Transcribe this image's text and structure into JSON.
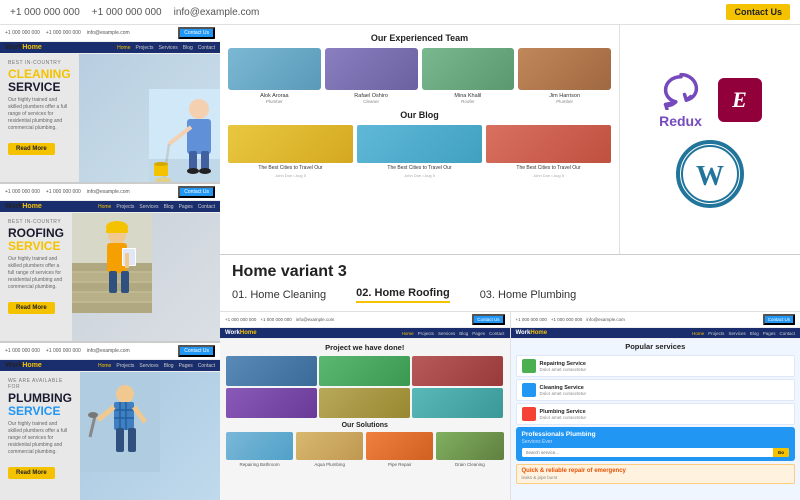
{
  "topbar": {
    "phone1": "+1 000 000 000",
    "phone2": "+1 000 000 000",
    "email": "info@example.com",
    "contact_btn": "Contact Us"
  },
  "previews": [
    {
      "id": "cleaning",
      "logo": "Work",
      "logo_accent": "Home",
      "tag": "BEST IN-COUNTRY",
      "headline_line1": "CLEANING",
      "headline_line2": "SERVICE",
      "desc": "Our highly trained and skilled plumbers offer a full range of services for residential plumbing and commercial plumbing.",
      "btn": "Read More",
      "nav": [
        "Home",
        "Projects",
        "Services",
        "Blog",
        "Contact"
      ],
      "type": "cleaning"
    },
    {
      "id": "roofing",
      "logo": "Work",
      "logo_accent": "Home",
      "tag": "BEST IN-COUNTRY",
      "headline_line1": "ROOFING",
      "headline_line2": "SERVICE",
      "desc": "Our highly trained and skilled plumbers offer a full range of services for residential plumbing and commercial plumbing.",
      "btn": "Read More",
      "nav": [
        "Home",
        "Projects",
        "Services",
        "Blog",
        "Pages",
        "Contact"
      ],
      "type": "roofing"
    },
    {
      "id": "plumbing",
      "logo": "Work",
      "logo_accent": "Home",
      "tag": "WE ARE AVAILABLE FOR",
      "headline_line1": "PLUMBING",
      "headline_line2": "SERVICE",
      "desc": "Our highly trained and skilled plumbers offer a full range of services for residential plumbing and commercial plumbing.",
      "btn": "Read More",
      "nav": [
        "Home",
        "Projects",
        "Services",
        "Blog",
        "Pages",
        "Contact"
      ],
      "type": "plumbing"
    }
  ],
  "center_panel": {
    "team_title": "Our Experienced Team",
    "team_members": [
      {
        "name": "Alok Aroraa",
        "role": "Plumber",
        "color": "t1"
      },
      {
        "name": "Rafael Oshiro",
        "role": "Cleaner",
        "color": "t2"
      },
      {
        "name": "Mina Khalil",
        "role": "Roofer",
        "color": "t3"
      },
      {
        "name": "Jim Harrison",
        "role": "Plumber",
        "color": "t4"
      }
    ],
    "blog_title": "Our Blog",
    "blog_posts": [
      {
        "caption": "The Best Cities to Travel Our",
        "meta": "John Doe  •  Aug 5",
        "color": "b1"
      },
      {
        "caption": "The Best Cities to Travel Our",
        "meta": "John Doe  •  Aug 5",
        "color": "b2"
      },
      {
        "caption": "The Best Cities to Travel Our",
        "meta": "John Doe  •  Aug 5",
        "color": "b3"
      }
    ]
  },
  "logos_panel": {
    "redux_label": "Redux",
    "elementor_label": "E",
    "wordpress_label": "WordPress"
  },
  "variants_section": {
    "title": "Home variant 3",
    "items": [
      {
        "label": "01. Home Cleaning",
        "active": false
      },
      {
        "label": "02. Home Roofing",
        "active": true
      },
      {
        "label": "03. Home Plumbing",
        "active": false
      }
    ]
  },
  "bottom_panels": {
    "left": {
      "logo": "Work",
      "logo_accent": "Home",
      "projects_title": "Project we have done!",
      "projects": [
        "p1",
        "p2",
        "p3",
        "p4",
        "p5",
        "p6"
      ],
      "solutions_title": "Our Solutions",
      "solutions": [
        {
          "label": "Repairing Bathroom",
          "color": "s1"
        },
        {
          "label": "Aqua Plumbing",
          "color": "s2"
        },
        {
          "label": "Pipe Repair",
          "color": "s3"
        },
        {
          "label": "Drain Cleaning",
          "color": "s4"
        }
      ]
    },
    "right": {
      "logo": "Work",
      "logo_accent": "Home",
      "popular_title": "Popular services",
      "services": [
        {
          "title": "Repairing Service",
          "desc": "Dolor amet consectetur"
        },
        {
          "title": "Cleaning Service",
          "desc": "Dolor amet consectetur"
        },
        {
          "title": "Plumbing Service",
          "desc": "Dolor amet consectetur"
        }
      ],
      "plumbing_title": "Professionals Plumbing",
      "plumbing_subtitle": "Services Ever",
      "search_placeholder": "Search service...",
      "search_btn": "Go",
      "emergency_title": "Quick & reliable repair of emergency",
      "emergency_desc": "leaks & pipe burst"
    }
  }
}
